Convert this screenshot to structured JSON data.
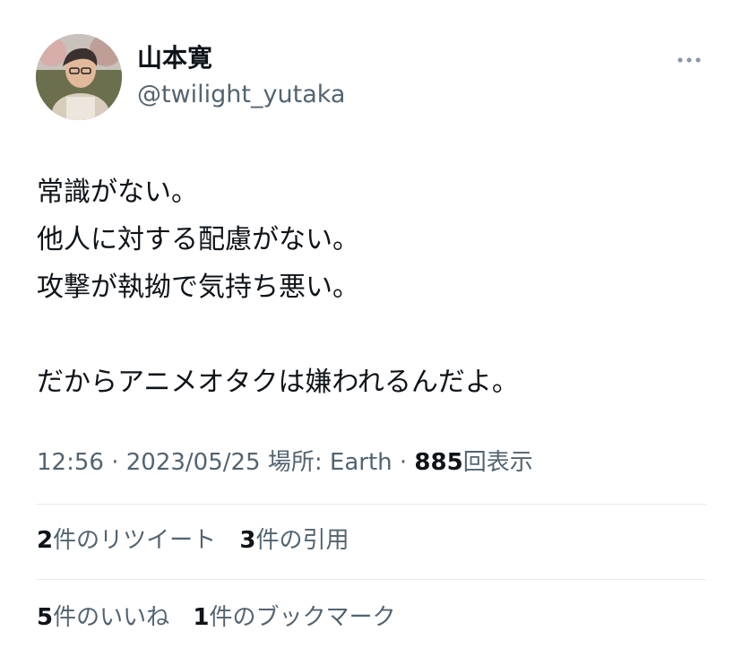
{
  "author": {
    "display_name": "山本寛",
    "handle": "@twilight_yutaka"
  },
  "tweet": {
    "lines": [
      "常識がない。",
      "他人に対する配慮がない。",
      "攻撃が執拗で気持ち悪い。",
      "",
      "だからアニメオタクは嫌われるんだよ。"
    ],
    "time": "12:56",
    "sep1": " · ",
    "date": "2023/05/25",
    "location_label": " 場所: ",
    "location": "Earth",
    "sep2": " · ",
    "views_count": "885",
    "views_label": "回表示"
  },
  "engagement": {
    "retweets": {
      "count": "2",
      "label": "件のリツイート"
    },
    "quotes": {
      "count": "3",
      "label": "件の引用"
    },
    "likes": {
      "count": "5",
      "label": "件のいいね"
    },
    "bookmarks": {
      "count": "1",
      "label": "件のブックマーク"
    }
  },
  "icons": {
    "more": "more-horizontal-icon"
  },
  "colors": {
    "text_primary": "#0f1419",
    "text_secondary": "#536471",
    "divider": "#e6e9ec"
  }
}
